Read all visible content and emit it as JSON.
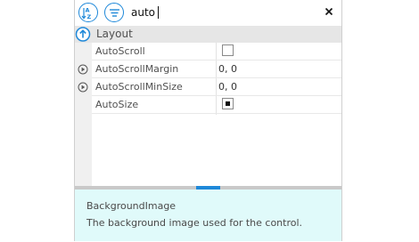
{
  "toolbar": {
    "sort_alpha_icon": "sort-alphabetical-icon",
    "categorized_icon": "categorized-list-icon",
    "search_value": "auto",
    "clear_icon": "close-icon"
  },
  "category": {
    "label": "Layout",
    "icon": "collapse-arrow-up-icon"
  },
  "properties": [
    {
      "name": "AutoScroll",
      "value_type": "checkbox",
      "checked": false,
      "expandable": false
    },
    {
      "name": "AutoScrollMargin",
      "value": "0, 0",
      "expandable": true
    },
    {
      "name": "AutoScrollMinSize",
      "value": "0, 0",
      "expandable": true
    },
    {
      "name": "AutoSize",
      "value_type": "checkbox",
      "checked": true,
      "expandable": false
    }
  ],
  "help": {
    "title": "BackgroundImage",
    "description": "The background image used for the control."
  },
  "colors": {
    "accent": "#1e88d9",
    "help_background": "#e0fafa",
    "category_background": "#e6e6e6"
  }
}
